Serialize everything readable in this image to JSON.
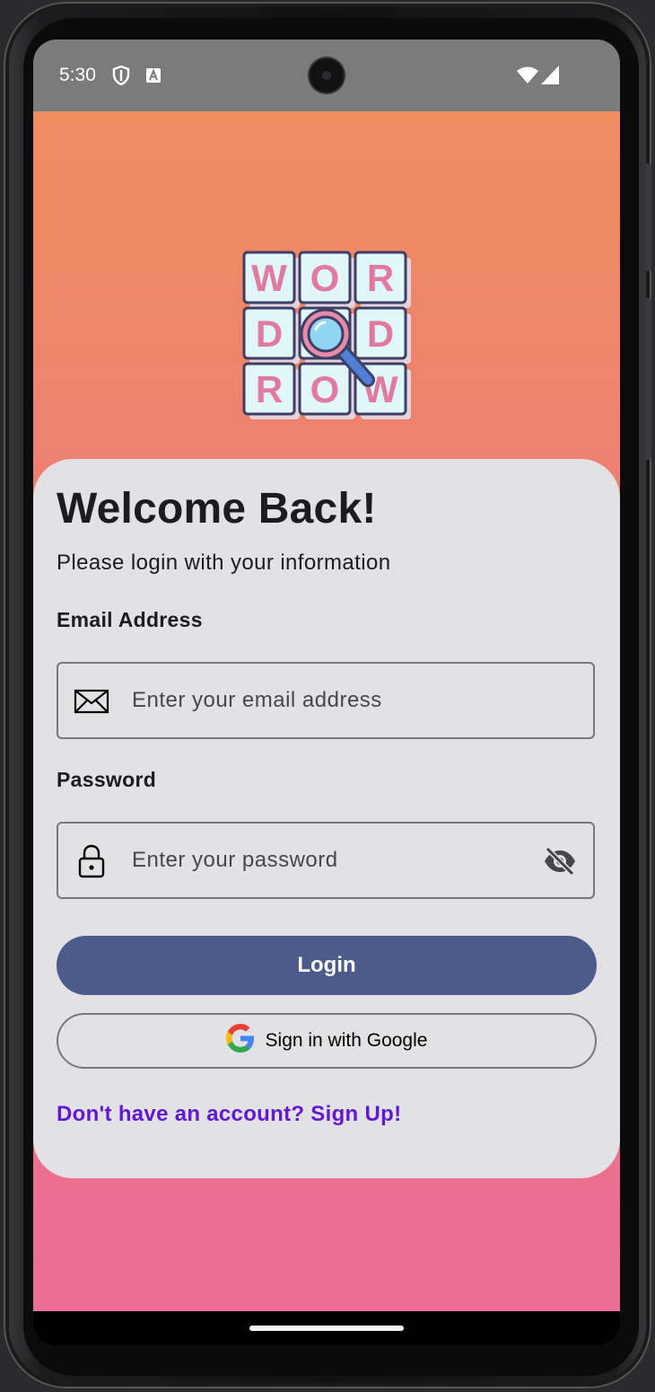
{
  "status_bar": {
    "time": "5:30",
    "icons": [
      "shield-icon",
      "font-a-icon",
      "wifi-icon",
      "cell-signal-icon"
    ]
  },
  "logo": {
    "rows": [
      [
        "W",
        "O",
        "R"
      ],
      [
        "D",
        "",
        "D"
      ],
      [
        "R",
        "O",
        "W"
      ]
    ],
    "icon": "magnifier-icon"
  },
  "login_card": {
    "title": "Welcome Back!",
    "subtitle": "Please login with your information",
    "email": {
      "label": "Email Address",
      "placeholder": "Enter your email address",
      "value": "",
      "icon": "envelope-icon"
    },
    "password": {
      "label": "Password",
      "placeholder": "Enter your password",
      "value": "",
      "icon": "lock-icon",
      "toggle_icon": "eye-off-icon"
    },
    "login_button": "Login",
    "google_button": "Sign in with Google",
    "signup_link": "Don't have an account? Sign Up!"
  },
  "colors": {
    "gradient_top": "#f08d5e",
    "gradient_bottom": "#ec6d96",
    "card_bg": "#e2e2e5",
    "primary_button": "#4a5b8c",
    "link": "#6318d4",
    "tile_fill": "#dff6fb",
    "tile_letter": "#e07aa0",
    "tile_border": "#3d3f66"
  }
}
